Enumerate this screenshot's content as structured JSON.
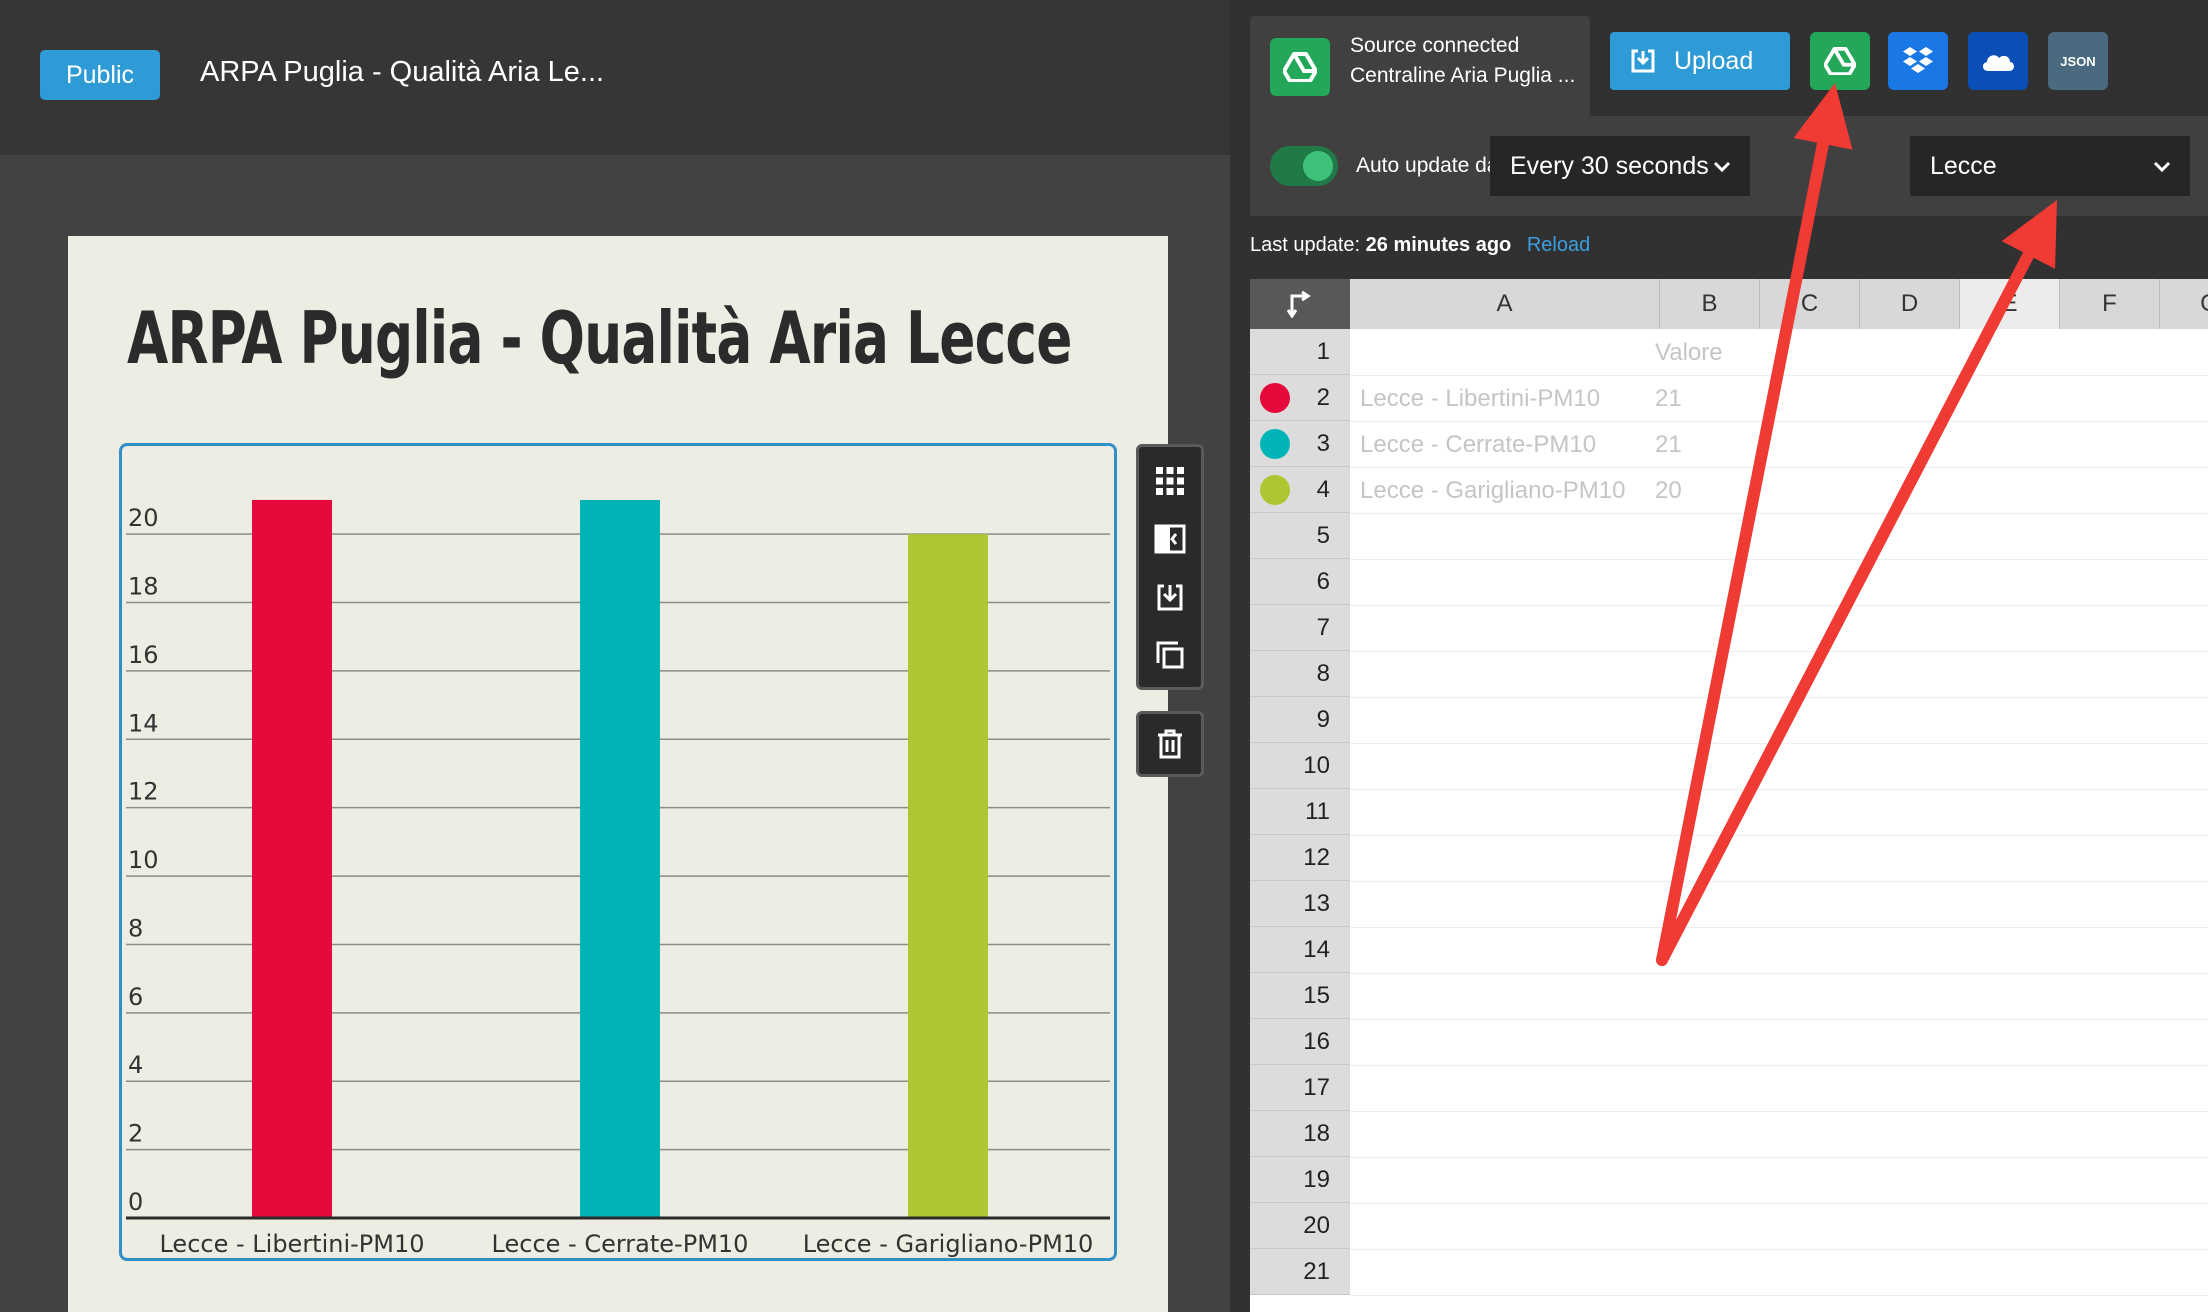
{
  "editor": {
    "visibility_label": "Public",
    "project_title": "ARPA Puglia - Qualità Aria Le..."
  },
  "chart_data": {
    "type": "bar",
    "title": "ARPA Puglia - Qualità Aria Lecce",
    "categories": [
      "Lecce - Libertini-PM10",
      "Lecce - Cerrate-PM10",
      "Lecce - Garigliano-PM10"
    ],
    "values": [
      21,
      21,
      20
    ],
    "colors": [
      "#e60a3c",
      "#00b4b8",
      "#aec631"
    ],
    "yticks": [
      "0",
      "2",
      "4",
      "6",
      "8",
      "10",
      "12",
      "14",
      "16",
      "18",
      "20"
    ],
    "ylim": [
      0,
      21.7
    ],
    "grid": true
  },
  "data_panel": {
    "source_status": "Source connected",
    "source_name": "Centraline Aria Puglia ...",
    "upload_label": "Upload",
    "json_label": "JSON",
    "auto_update_label": "Auto update data",
    "auto_update_on": true,
    "interval_value": "Every 30 seconds",
    "city_value": "Lecce",
    "last_update_prefix": "Last update:",
    "last_update_value": "26 minutes ago",
    "reload_label": "Reload",
    "accent_color": "#2e9bd6",
    "toggle_color": "#1f7a47"
  },
  "sheet": {
    "columns": [
      "A",
      "B",
      "C",
      "D",
      "E",
      "F",
      "G"
    ],
    "rows": [
      "1",
      "2",
      "3",
      "4",
      "5",
      "6",
      "7",
      "8",
      "9",
      "10",
      "11",
      "12",
      "13",
      "14",
      "15",
      "16",
      "17",
      "18",
      "19",
      "20",
      "21"
    ],
    "header_value": "Valore",
    "series_rows": [
      {
        "label": "Lecce - Libertini-PM10",
        "value": "21",
        "color": "#e60a3c"
      },
      {
        "label": "Lecce - Cerrate-PM10",
        "value": "21",
        "color": "#00b4b8"
      },
      {
        "label": "Lecce - Garigliano-PM10",
        "value": "20",
        "color": "#aec631"
      }
    ]
  },
  "annotation_color": "#f03a34"
}
